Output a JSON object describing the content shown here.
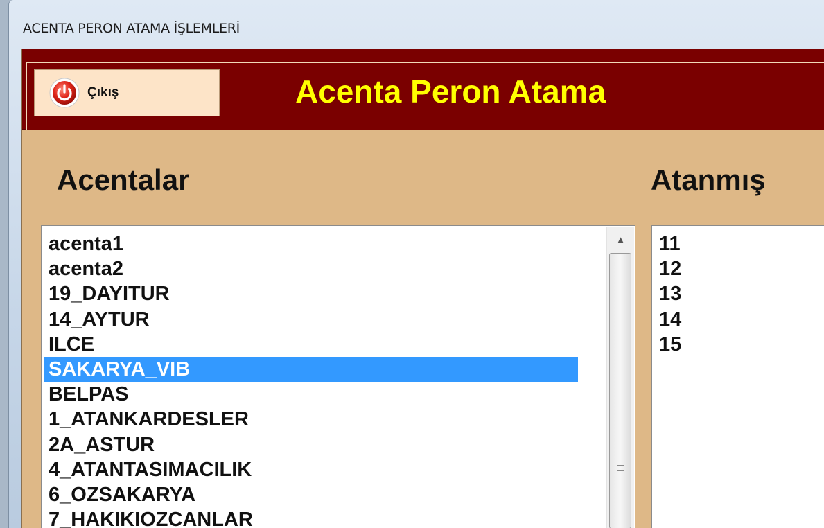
{
  "window": {
    "title": "ACENTA PERON ATAMA İŞLEMLERİ"
  },
  "header": {
    "exit_label": "Çıkış",
    "title": "Acenta Peron Atama"
  },
  "sections": {
    "acentalar_label": "Acentalar",
    "atanmis_label": "Atanmış"
  },
  "acenta_list": {
    "selected": "SAKARYA_VIB",
    "items": [
      "acenta1",
      "acenta2",
      "19_DAYITUR",
      "14_AYTUR",
      "ILCE",
      "SAKARYA_VIB",
      "BELPAS",
      "1_ATANKARDESLER",
      "2A_ASTUR",
      "4_ATANTASIMACILIK",
      "6_OZSAKARYA",
      "7_HAKIKIOZCANLAR"
    ]
  },
  "peron_list": {
    "items": [
      "11",
      "12",
      "13",
      "14",
      "15"
    ]
  },
  "colors": {
    "header_bg": "#7a0000",
    "header_title": "#ffff00",
    "form_bg": "#deb887",
    "selection": "#3399ff"
  }
}
